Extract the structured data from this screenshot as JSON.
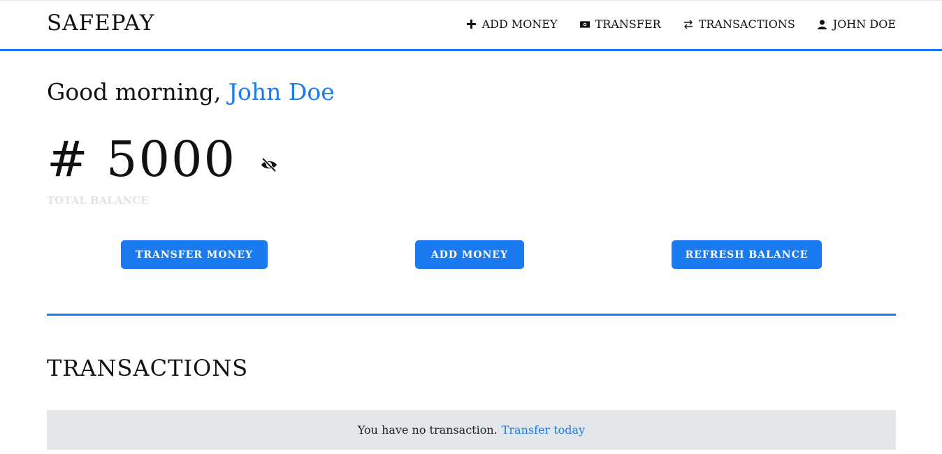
{
  "app": {
    "brand": "SAFEPAY",
    "accent_color": "#1a7bf0"
  },
  "nav": {
    "items": [
      {
        "icon": "plus-icon",
        "label": "Add Money"
      },
      {
        "icon": "money-bill-icon",
        "label": "Transfer"
      },
      {
        "icon": "exchange-arrows-icon",
        "label": "Transactions"
      },
      {
        "icon": "user-icon",
        "label": "John Doe"
      }
    ]
  },
  "greeting": {
    "prefix": "Good morning,",
    "name": "John Doe"
  },
  "balance": {
    "amount": "# 5000",
    "label": "Total Balance",
    "toggle_icon": "eye-slash-icon"
  },
  "actions": {
    "transfer_label": "Transfer Money",
    "add_label": "Add Money",
    "refresh_label": "Refresh Balance"
  },
  "transactions": {
    "title": "Transactions",
    "empty_text": "You have no transaction.",
    "empty_link": "Transfer today"
  }
}
